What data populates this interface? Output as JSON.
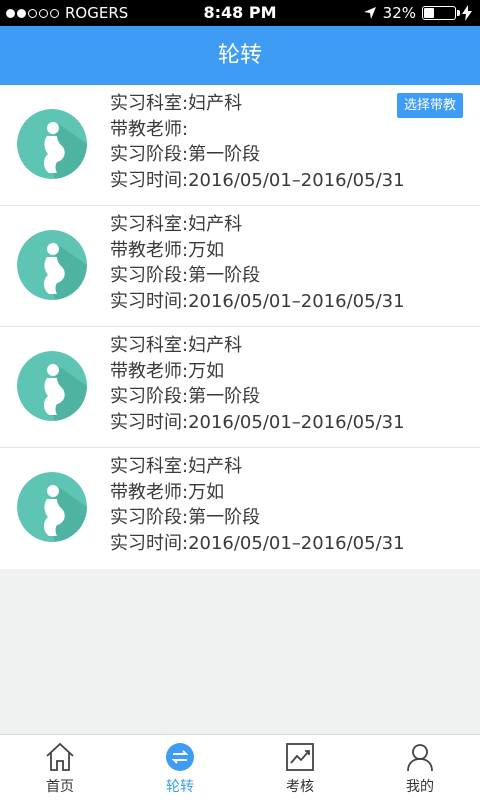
{
  "statusbar": {
    "carrier": "ROGERS",
    "time": "8:48 PM",
    "battery": "32%",
    "battery_level": 0.32,
    "signal_bars": 2
  },
  "header": {
    "title": "轮转"
  },
  "list": {
    "items": [
      {
        "department": "实习科室:妇产科",
        "teacher": "带教老师:",
        "stage": "实习阶段:第一阶段",
        "period": "实习时间:2016/05/01–2016/05/31",
        "action": "选择带教"
      },
      {
        "department": "实习科室:妇产科",
        "teacher": "带教老师:万如",
        "stage": "实习阶段:第一阶段",
        "period": "实习时间:2016/05/01–2016/05/31"
      },
      {
        "department": "实习科室:妇产科",
        "teacher": "带教老师:万如",
        "stage": "实习阶段:第一阶段",
        "period": "实习时间:2016/05/01–2016/05/31"
      },
      {
        "department": "实习科室:妇产科",
        "teacher": "带教老师:万如",
        "stage": "实习阶段:第一阶段",
        "period": "实习时间:2016/05/01–2016/05/31"
      }
    ]
  },
  "tabbar": {
    "tabs": [
      {
        "label": "首页",
        "icon": "home-icon"
      },
      {
        "label": "轮转",
        "icon": "swap-icon",
        "active": true
      },
      {
        "label": "考核",
        "icon": "chart-icon"
      },
      {
        "label": "我的",
        "icon": "user-icon"
      }
    ]
  },
  "colors": {
    "accent": "#3f9cf5",
    "avatar": "#5ec4b3"
  }
}
